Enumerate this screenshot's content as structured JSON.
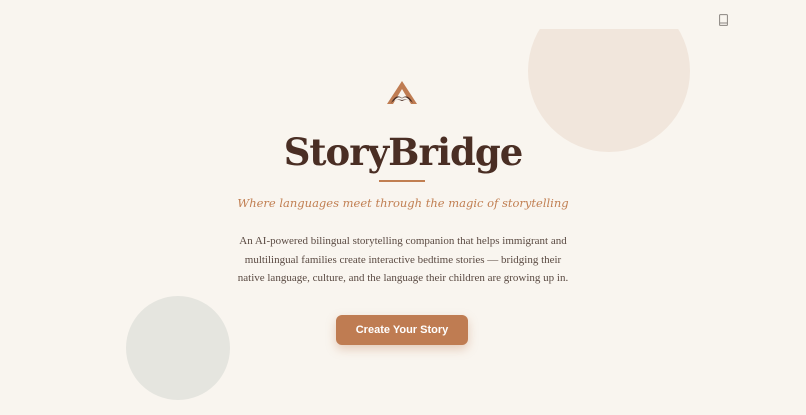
{
  "colors": {
    "background": "#f9f5ef",
    "accent": "#bf7c52",
    "title": "#4a2e24",
    "text": "#5a4a42",
    "circle_beige": "#f1e6dc",
    "circle_sage": "#e5e5df"
  },
  "header": {
    "book_icon": "book-icon"
  },
  "hero": {
    "logo_icon": "open-book-icon",
    "title": "StoryBridge",
    "tagline": "Where languages meet through the magic of storytelling",
    "description": "An AI-powered bilingual storytelling companion that helps immigrant and multilingual families create interactive bedtime stories — bridging their native language, culture, and the language their children are growing up in.",
    "cta_label": "Create Your Story"
  }
}
